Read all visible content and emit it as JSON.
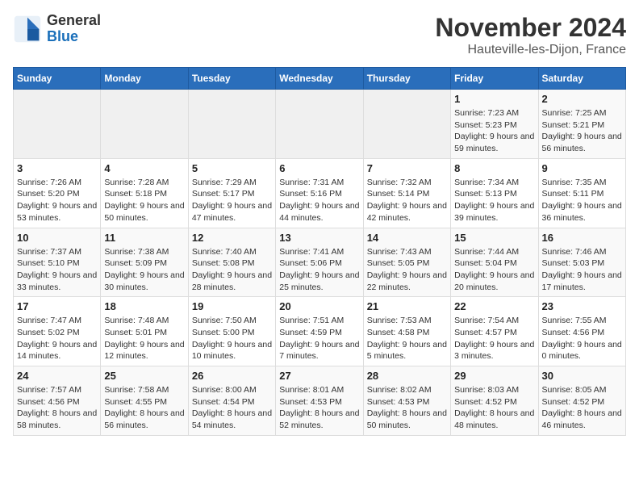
{
  "logo": {
    "general": "General",
    "blue": "Blue"
  },
  "header": {
    "title": "November 2024",
    "subtitle": "Hauteville-les-Dijon, France"
  },
  "weekdays": [
    "Sunday",
    "Monday",
    "Tuesday",
    "Wednesday",
    "Thursday",
    "Friday",
    "Saturday"
  ],
  "weeks": [
    [
      {
        "day": "",
        "info": ""
      },
      {
        "day": "",
        "info": ""
      },
      {
        "day": "",
        "info": ""
      },
      {
        "day": "",
        "info": ""
      },
      {
        "day": "",
        "info": ""
      },
      {
        "day": "1",
        "info": "Sunrise: 7:23 AM\nSunset: 5:23 PM\nDaylight: 9 hours and 59 minutes."
      },
      {
        "day": "2",
        "info": "Sunrise: 7:25 AM\nSunset: 5:21 PM\nDaylight: 9 hours and 56 minutes."
      }
    ],
    [
      {
        "day": "3",
        "info": "Sunrise: 7:26 AM\nSunset: 5:20 PM\nDaylight: 9 hours and 53 minutes."
      },
      {
        "day": "4",
        "info": "Sunrise: 7:28 AM\nSunset: 5:18 PM\nDaylight: 9 hours and 50 minutes."
      },
      {
        "day": "5",
        "info": "Sunrise: 7:29 AM\nSunset: 5:17 PM\nDaylight: 9 hours and 47 minutes."
      },
      {
        "day": "6",
        "info": "Sunrise: 7:31 AM\nSunset: 5:16 PM\nDaylight: 9 hours and 44 minutes."
      },
      {
        "day": "7",
        "info": "Sunrise: 7:32 AM\nSunset: 5:14 PM\nDaylight: 9 hours and 42 minutes."
      },
      {
        "day": "8",
        "info": "Sunrise: 7:34 AM\nSunset: 5:13 PM\nDaylight: 9 hours and 39 minutes."
      },
      {
        "day": "9",
        "info": "Sunrise: 7:35 AM\nSunset: 5:11 PM\nDaylight: 9 hours and 36 minutes."
      }
    ],
    [
      {
        "day": "10",
        "info": "Sunrise: 7:37 AM\nSunset: 5:10 PM\nDaylight: 9 hours and 33 minutes."
      },
      {
        "day": "11",
        "info": "Sunrise: 7:38 AM\nSunset: 5:09 PM\nDaylight: 9 hours and 30 minutes."
      },
      {
        "day": "12",
        "info": "Sunrise: 7:40 AM\nSunset: 5:08 PM\nDaylight: 9 hours and 28 minutes."
      },
      {
        "day": "13",
        "info": "Sunrise: 7:41 AM\nSunset: 5:06 PM\nDaylight: 9 hours and 25 minutes."
      },
      {
        "day": "14",
        "info": "Sunrise: 7:43 AM\nSunset: 5:05 PM\nDaylight: 9 hours and 22 minutes."
      },
      {
        "day": "15",
        "info": "Sunrise: 7:44 AM\nSunset: 5:04 PM\nDaylight: 9 hours and 20 minutes."
      },
      {
        "day": "16",
        "info": "Sunrise: 7:46 AM\nSunset: 5:03 PM\nDaylight: 9 hours and 17 minutes."
      }
    ],
    [
      {
        "day": "17",
        "info": "Sunrise: 7:47 AM\nSunset: 5:02 PM\nDaylight: 9 hours and 14 minutes."
      },
      {
        "day": "18",
        "info": "Sunrise: 7:48 AM\nSunset: 5:01 PM\nDaylight: 9 hours and 12 minutes."
      },
      {
        "day": "19",
        "info": "Sunrise: 7:50 AM\nSunset: 5:00 PM\nDaylight: 9 hours and 10 minutes."
      },
      {
        "day": "20",
        "info": "Sunrise: 7:51 AM\nSunset: 4:59 PM\nDaylight: 9 hours and 7 minutes."
      },
      {
        "day": "21",
        "info": "Sunrise: 7:53 AM\nSunset: 4:58 PM\nDaylight: 9 hours and 5 minutes."
      },
      {
        "day": "22",
        "info": "Sunrise: 7:54 AM\nSunset: 4:57 PM\nDaylight: 9 hours and 3 minutes."
      },
      {
        "day": "23",
        "info": "Sunrise: 7:55 AM\nSunset: 4:56 PM\nDaylight: 9 hours and 0 minutes."
      }
    ],
    [
      {
        "day": "24",
        "info": "Sunrise: 7:57 AM\nSunset: 4:56 PM\nDaylight: 8 hours and 58 minutes."
      },
      {
        "day": "25",
        "info": "Sunrise: 7:58 AM\nSunset: 4:55 PM\nDaylight: 8 hours and 56 minutes."
      },
      {
        "day": "26",
        "info": "Sunrise: 8:00 AM\nSunset: 4:54 PM\nDaylight: 8 hours and 54 minutes."
      },
      {
        "day": "27",
        "info": "Sunrise: 8:01 AM\nSunset: 4:53 PM\nDaylight: 8 hours and 52 minutes."
      },
      {
        "day": "28",
        "info": "Sunrise: 8:02 AM\nSunset: 4:53 PM\nDaylight: 8 hours and 50 minutes."
      },
      {
        "day": "29",
        "info": "Sunrise: 8:03 AM\nSunset: 4:52 PM\nDaylight: 8 hours and 48 minutes."
      },
      {
        "day": "30",
        "info": "Sunrise: 8:05 AM\nSunset: 4:52 PM\nDaylight: 8 hours and 46 minutes."
      }
    ]
  ]
}
